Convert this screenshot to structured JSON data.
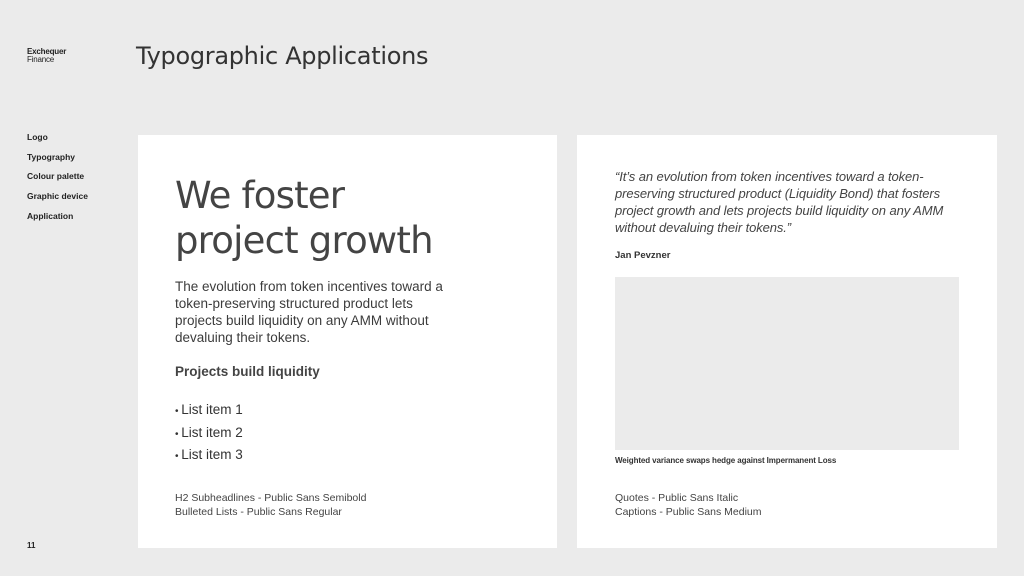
{
  "brand": {
    "line1": "Exchequer",
    "line2": "Finance"
  },
  "page_title": "Typographic Applications",
  "nav": {
    "items": [
      {
        "label": "Logo"
      },
      {
        "label": "Typography"
      },
      {
        "label": "Colour palette"
      },
      {
        "label": "Graphic device"
      },
      {
        "label": "Application"
      }
    ]
  },
  "page_number": "11",
  "left_card": {
    "headline": "We foster project growth",
    "body": "The evolution from token incentives toward a token-preserving structured product lets projects build liquidity on any AMM without devaluing their tokens.",
    "subhead": "Projects build liquidity",
    "list": [
      "List item 1",
      "List item 2",
      "List item 3"
    ],
    "spec_line1": "H2 Subheadlines - Public Sans Semibold",
    "spec_line2": "Bulleted Lists - Public Sans Regular"
  },
  "right_card": {
    "quote": "“It’s an evolution from token incentives toward a token-preserving structured product (Liquidity Bond) that fosters project growth and lets projects build liquidity on any AMM without devaluing their tokens.”",
    "author": "Jan Pevzner",
    "caption": "Weighted variance swaps hedge against Impermanent Loss",
    "spec_line1": "Quotes - Public Sans Italic",
    "spec_line2": "Captions - Public Sans Medium"
  }
}
